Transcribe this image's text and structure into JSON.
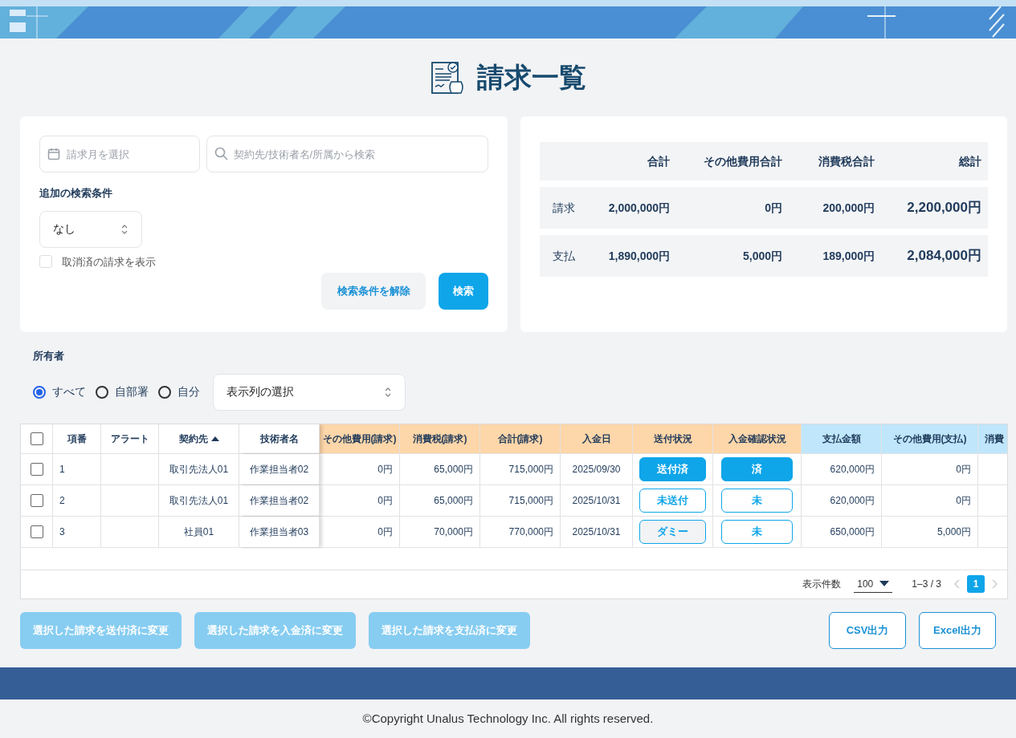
{
  "page_title": "請求一覧",
  "search": {
    "month_placeholder": "請求月を選択",
    "keyword_placeholder": "契約先/技術者名/所属から検索",
    "extra_label": "追加の検索条件",
    "extra_value": "なし",
    "show_cancelled": {
      "label": "取消済の請求を表示",
      "checked": false
    },
    "clear_button": "検索条件を解除",
    "search_button": "検索"
  },
  "summary": {
    "columns": [
      "",
      "合計",
      "その他費用合計",
      "消費税合計",
      "総計"
    ],
    "rows": [
      {
        "label": "請求",
        "values": [
          "2,000,000円",
          "0円",
          "200,000円",
          "2,200,000円"
        ]
      },
      {
        "label": "支払",
        "values": [
          "1,890,000円",
          "5,000円",
          "189,000円",
          "2,084,000円"
        ]
      }
    ]
  },
  "owner": {
    "label": "所有者",
    "options": [
      {
        "label": "すべて",
        "selected": true
      },
      {
        "label": "自部署",
        "selected": false
      },
      {
        "label": "自分",
        "selected": false
      }
    ],
    "column_select": "表示列の選択"
  },
  "table": {
    "all_checked": false,
    "columns": [
      {
        "label": "項番",
        "kind": "fixed",
        "sorted": false
      },
      {
        "label": "アラート",
        "kind": "fixed",
        "sorted": false
      },
      {
        "label": "契約先",
        "kind": "fixed",
        "sorted": true
      },
      {
        "label": "技術者名",
        "kind": "fixed",
        "sorted": false
      },
      {
        "label": "その他費用(請求)",
        "kind": "billing",
        "sorted": false
      },
      {
        "label": "消費税(請求)",
        "kind": "billing",
        "sorted": false
      },
      {
        "label": "合計(請求)",
        "kind": "billing",
        "sorted": false
      },
      {
        "label": "入金日",
        "kind": "billing",
        "sorted": false
      },
      {
        "label": "送付状況",
        "kind": "billing",
        "sorted": false
      },
      {
        "label": "入金確認状況",
        "kind": "billing",
        "sorted": false
      },
      {
        "label": "支払金額",
        "kind": "payment",
        "sorted": false
      },
      {
        "label": "その他費用(支払)",
        "kind": "payment",
        "sorted": false
      },
      {
        "label": "消費",
        "kind": "payment"
      }
    ],
    "rows": [
      {
        "checked": false,
        "no": "1",
        "alert": "",
        "client": "取引先法人01",
        "engineer": "作業担当者02",
        "other_cost": "0円",
        "tax": "65,000円",
        "total": "715,000円",
        "paid_date": "2025/09/30",
        "send_status": {
          "label": "送付済",
          "kind": "done"
        },
        "payment_status": {
          "label": "済",
          "kind": "done"
        },
        "pay_amount": "620,000円",
        "pay_other": "0円"
      },
      {
        "checked": false,
        "no": "2",
        "alert": "",
        "client": "取引先法人01",
        "engineer": "作業担当者02",
        "other_cost": "0円",
        "tax": "65,000円",
        "total": "715,000円",
        "paid_date": "2025/10/31",
        "send_status": {
          "label": "未送付",
          "kind": "pending"
        },
        "payment_status": {
          "label": "未",
          "kind": "pending"
        },
        "pay_amount": "620,000円",
        "pay_other": "0円"
      },
      {
        "checked": false,
        "no": "3",
        "alert": "",
        "client": "社員01",
        "engineer": "作業担当者03",
        "other_cost": "0円",
        "tax": "70,000円",
        "total": "770,000円",
        "paid_date": "2025/10/31",
        "send_status": {
          "label": "ダミー",
          "kind": "dummy"
        },
        "payment_status": {
          "label": "未",
          "kind": "pending"
        },
        "pay_amount": "650,000円",
        "pay_other": "5,000円"
      }
    ],
    "pagination": {
      "per_page_label": "表示件数",
      "per_page": "100",
      "range": "1–3 / 3",
      "pages": [
        {
          "label": "1",
          "selected": true
        }
      ]
    }
  },
  "actions": [
    {
      "label": "選択した請求を送付済に変更",
      "disabled": true
    },
    {
      "label": "選択した請求を入金済に変更",
      "disabled": true
    },
    {
      "label": "選択した請求を支払済に変更",
      "disabled": true
    }
  ],
  "exports": [
    "CSV出力",
    "Excel出力"
  ],
  "copyright": "©Copyright Unalus Technology Inc. All rights reserved."
}
